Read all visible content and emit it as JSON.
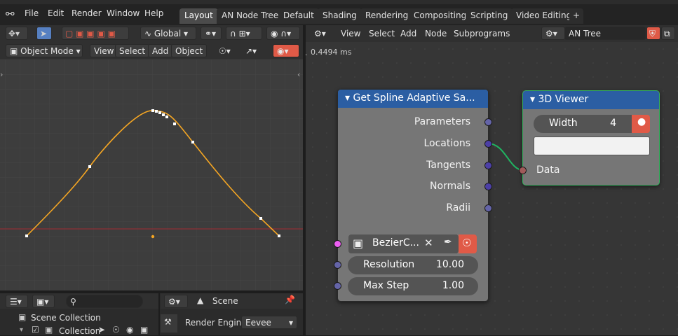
{
  "app": {
    "title": "Blender"
  },
  "topbar": {
    "menus": [
      "File",
      "Edit",
      "Render",
      "Window",
      "Help"
    ],
    "workspaces": [
      "Layout",
      "AN Node Tree",
      "Default",
      "Shading",
      "Rendering",
      "Compositing",
      "Scripting",
      "Video Editing"
    ],
    "active_workspace": "Layout",
    "add_label": "+"
  },
  "viewport": {
    "transform_orientation": "Global",
    "mode": "Object Mode",
    "menus": [
      "View",
      "Select",
      "Add",
      "Object"
    ]
  },
  "node_editor": {
    "menus": [
      "View",
      "Select",
      "Add",
      "Node",
      "Subprograms"
    ],
    "tree_name": "AN Tree",
    "timing": "0.4494 ms"
  },
  "node_spline": {
    "title": "Get Spline Adaptive Sa...",
    "outputs": [
      "Parameters",
      "Locations",
      "Tangents",
      "Normals",
      "Radii"
    ],
    "object_name": "BezierC...",
    "resolution_label": "Resolution",
    "resolution_value": "10.00",
    "maxstep_label": "Max Step",
    "maxstep_value": "1.00",
    "header_color": "#2b5ea3"
  },
  "node_viewer": {
    "title": "3D Viewer",
    "width_label": "Width",
    "width_value": "4",
    "data_label": "Data",
    "header_color": "#2b5ea3"
  },
  "outliner": {
    "search_placeholder": "",
    "scene_collection": "Scene Collection",
    "collection": "Collection"
  },
  "properties": {
    "scene_label": "Scene",
    "render_engine_label": "Render Engine",
    "render_engine_value": "Eevee"
  },
  "colors": {
    "accent": "#5680c2",
    "curve": "#f5a623",
    "link": "#1fb561",
    "selected": "#35b35e"
  }
}
